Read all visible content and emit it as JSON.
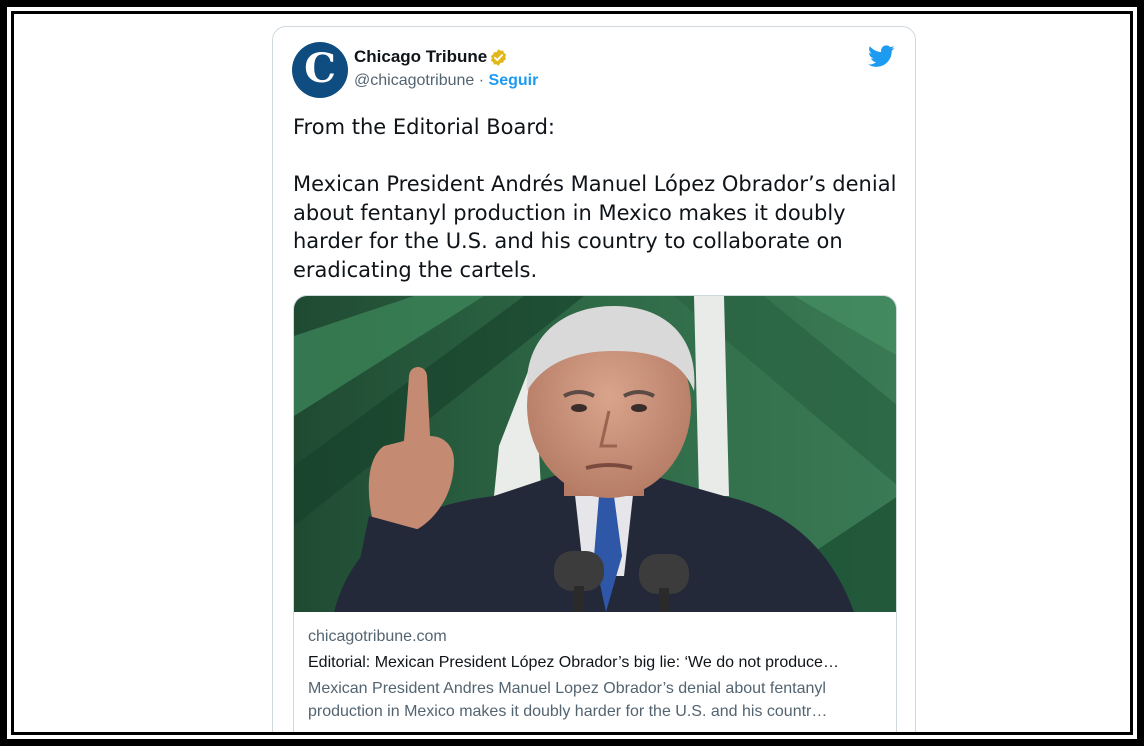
{
  "colors": {
    "accent": "#1d9bf0",
    "verified_gold": "#e2b719",
    "avatar_bg": "#0f4d80",
    "text_primary": "#0f1419",
    "text_secondary": "#536471",
    "border": "#cfd9de"
  },
  "author": {
    "name": "Chicago Tribune",
    "handle": "@chicagotribune",
    "separator": "·",
    "follow_label": "Seguir",
    "avatar_glyph": "C",
    "verified_icon": "verified-badge-icon"
  },
  "brand_icon": "twitter-bird-icon",
  "tweet": {
    "line1": "From the Editorial Board:",
    "body": "Mexican President Andrés Manuel López Obrador’s denial about fentanyl production in Mexico makes it doubly harder for the U.S. and his country to collaborate on eradicating the cartels."
  },
  "link_card": {
    "image_icon": "article-photo",
    "domain": "chicagotribune.com",
    "title": "Editorial: Mexican President López Obrador’s big lie: ‘We do not produce…",
    "description_line1": "Mexican President Andres Manuel Lopez Obrador’s denial about fentanyl",
    "description_line2": "production in Mexico makes it doubly harder for the U.S. and his countr…"
  }
}
